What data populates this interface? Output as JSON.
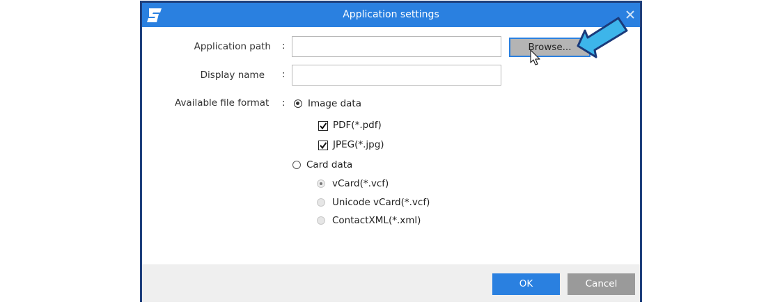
{
  "dialog": {
    "title": "Application settings",
    "logo_icon": "scansnap-logo-icon",
    "close_icon": "close-icon"
  },
  "form": {
    "app_path_label": "Application path",
    "app_path_value": "",
    "display_name_label": "Display name",
    "display_name_value": "",
    "file_format_label": "Available file format",
    "colon": ":",
    "browse_label": "Browse..."
  },
  "formats": {
    "image_data": {
      "label": "Image data",
      "selected": true
    },
    "pdf": {
      "label": "PDF(*.pdf)",
      "checked": true
    },
    "jpeg": {
      "label": "JPEG(*.jpg)",
      "checked": true
    },
    "card_data": {
      "label": "Card data",
      "selected": false
    },
    "vcard": {
      "label": "vCard(*.vcf)",
      "selected": true,
      "enabled": false
    },
    "unicode_vcard": {
      "label": "Unicode vCard(*.vcf)",
      "selected": false,
      "enabled": false
    },
    "contactxml": {
      "label": "ContactXML(*.xml)",
      "selected": false,
      "enabled": false
    }
  },
  "footer": {
    "ok_label": "OK",
    "cancel_label": "Cancel"
  },
  "annotations": {
    "arrow_icon": "pointer-arrow-icon",
    "cursor_icon": "mouse-cursor-icon",
    "arrow_color": "#3db5ea"
  },
  "colors": {
    "accent": "#2a80e0",
    "border": "#1e3f7c"
  }
}
